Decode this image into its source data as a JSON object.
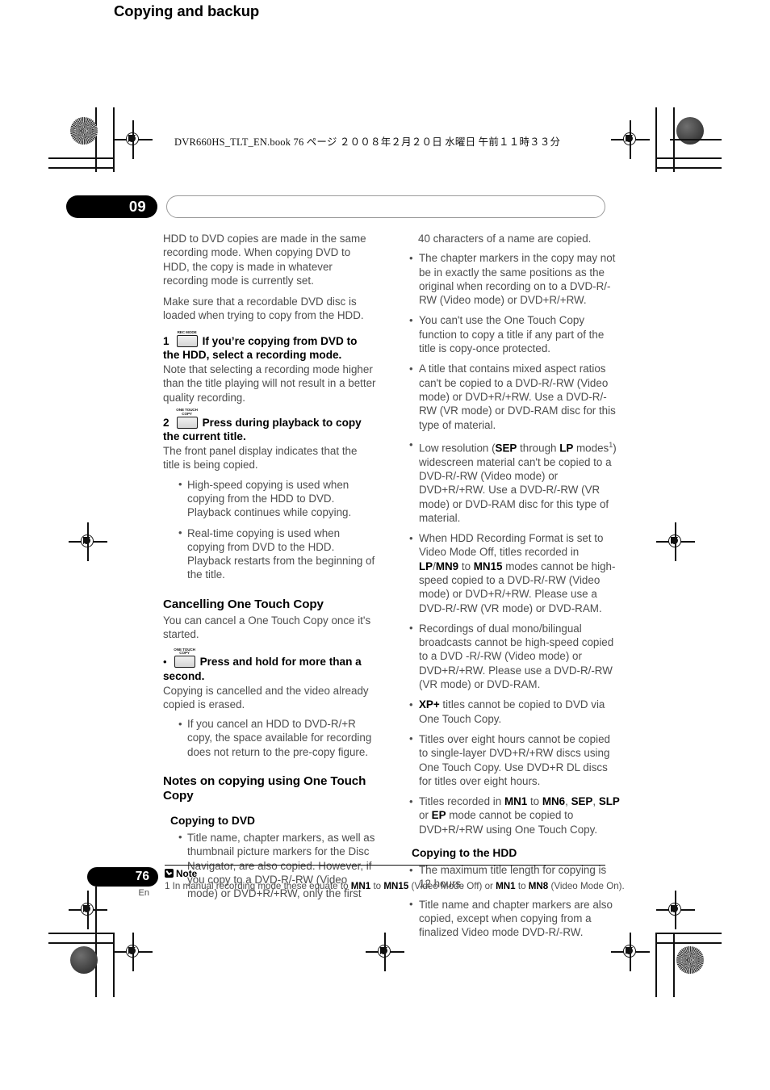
{
  "imprint": "DVR660HS_TLT_EN.book   76 ページ   ２００８年２月２０日   水曜日   午前１１時３３分",
  "chapter": {
    "number": "09",
    "title": "Copying and backup"
  },
  "left_column": {
    "intro_1": "HDD to DVD copies are made in the same recording mode. When copying DVD to HDD, the copy is made in whatever recording mode is currently set.",
    "intro_2": "Make sure that a recordable DVD disc is loaded when trying to copy from the HDD.",
    "step1": {
      "number": "1",
      "key_label_line1": "REC MODE",
      "key_name": "rec-mode-button",
      "title": "If you’re copying from DVD to the HDD, select a recording mode.",
      "body": "Note that selecting a recording mode higher than the title playing will not result in a better quality recording."
    },
    "step2": {
      "number": "2",
      "key_label_line1": "ONE TOUCH",
      "key_label_line2": "COPY",
      "key_name": "one-touch-copy-button",
      "title": "Press during playback to copy the current title.",
      "body": "The front panel display indicates that the title is being copied.",
      "bullets": [
        "High-speed copying is used when copying from the HDD to DVD. Playback continues while copying.",
        "Real-time copying is used when copying from DVD to the HDD. Playback restarts from the beginning of the title."
      ]
    },
    "cancel_section": {
      "heading": "Cancelling One Touch Copy",
      "intro": "You can cancel a One Touch Copy once it's started.",
      "action": {
        "key_label_line1": "ONE TOUCH",
        "key_label_line2": "COPY",
        "key_name": "one-touch-copy-button",
        "title": "Press and hold for more than a second.",
        "body": "Copying is cancelled and the video already copied is erased."
      },
      "bullets": [
        "If you cancel an HDD to DVD-R/+R copy, the space available for recording does not return to the pre-copy figure."
      ]
    },
    "notes_section": {
      "heading": "Notes on copying using One Touch Copy",
      "subheading": "Copying to DVD",
      "bullet_continued": "Title name, chapter markers, as well as thumbnail picture markers for the Disc Navigator, are also copied. However, if you copy to a DVD-R/-RW (Video mode) or DVD+R/+RW, only the first"
    }
  },
  "right_column": {
    "continued_text": "40 characters of a name are copied.",
    "dvd_bullets": [
      {
        "parts": [
          {
            "t": "The chapter markers in the copy may not be in exactly the same positions as the original when recording on to a DVD-R/-RW (Video mode) or DVD+R/+RW.",
            "b": false
          }
        ]
      },
      {
        "parts": [
          {
            "t": "You can't use the One Touch Copy function to copy a title if any part of the title is copy-once protected.",
            "b": false
          }
        ]
      },
      {
        "parts": [
          {
            "t": "A title that contains mixed aspect ratios can't be copied to a DVD-R/-RW (Video mode) or DVD+R/+RW. Use a DVD-R/-RW (VR mode) or DVD-RAM disc for this type of material.",
            "b": false
          }
        ]
      },
      {
        "parts": [
          {
            "t": "Low resolution (",
            "b": false
          },
          {
            "t": "SEP",
            "b": true
          },
          {
            "t": " through ",
            "b": false
          },
          {
            "t": "LP",
            "b": true
          },
          {
            "t": " modes",
            "b": false
          },
          {
            "t": "1",
            "sup": true
          },
          {
            "t": ") widescreen material can't be copied to a DVD-R/-RW (Video mode) or DVD+R/+RW. Use a DVD-R/-RW (VR mode) or DVD-RAM disc for this type of material.",
            "b": false
          }
        ]
      },
      {
        "parts": [
          {
            "t": "When HDD Recording Format is set to Video Mode Off, titles recorded in ",
            "b": false
          },
          {
            "t": "LP",
            "b": true
          },
          {
            "t": "/",
            "b": false
          },
          {
            "t": "MN9",
            "b": true
          },
          {
            "t": " to ",
            "b": false
          },
          {
            "t": "MN15",
            "b": true
          },
          {
            "t": " modes cannot be high-speed copied to a DVD-R/-RW (Video mode) or DVD+R/+RW. Please use a DVD-R/-RW (VR mode) or DVD-RAM.",
            "b": false
          }
        ]
      },
      {
        "parts": [
          {
            "t": "Recordings of dual mono/bilingual broadcasts cannot be high-speed copied to a DVD -R/-RW (Video mode) or DVD+R/+RW. Please use a DVD-R/-RW (VR mode) or DVD-RAM.",
            "b": false
          }
        ]
      },
      {
        "parts": [
          {
            "t": "XP+",
            "b": true
          },
          {
            "t": " titles cannot be copied to DVD via One Touch Copy.",
            "b": false
          }
        ]
      },
      {
        "parts": [
          {
            "t": "Titles over eight hours cannot be copied to single-layer DVD+R/+RW discs using One Touch Copy. Use DVD+R DL discs for titles over eight hours.",
            "b": false
          }
        ]
      },
      {
        "parts": [
          {
            "t": "Titles recorded in ",
            "b": false
          },
          {
            "t": "MN1",
            "b": true
          },
          {
            "t": " to ",
            "b": false
          },
          {
            "t": "MN6",
            "b": true
          },
          {
            "t": ", ",
            "b": false
          },
          {
            "t": "SEP",
            "b": true
          },
          {
            "t": ", ",
            "b": false
          },
          {
            "t": "SLP",
            "b": true
          },
          {
            "t": " or ",
            "b": false
          },
          {
            "t": "EP",
            "b": true
          },
          {
            "t": " mode cannot be copied to DVD+R/+RW using One Touch Copy.",
            "b": false
          }
        ]
      }
    ],
    "hdd_subheading": "Copying to the HDD",
    "hdd_bullets": [
      {
        "parts": [
          {
            "t": "The maximum title length for copying is 12 hours.",
            "b": false
          }
        ]
      },
      {
        "parts": [
          {
            "t": "Title name and chapter markers are also copied, except when copying from a finalized Video mode DVD-R/-RW.",
            "b": false
          }
        ]
      }
    ]
  },
  "footer": {
    "page_number": "76",
    "language": "En",
    "note_label": "Note",
    "note_parts": [
      {
        "t": "1 In manual recording mode these equate to ",
        "b": false
      },
      {
        "t": "MN1",
        "b": true
      },
      {
        "t": " to ",
        "b": false
      },
      {
        "t": "MN15",
        "b": true
      },
      {
        "t": " (Video Mode Off) or ",
        "b": false
      },
      {
        "t": "MN1",
        "b": true
      },
      {
        "t": " to ",
        "b": false
      },
      {
        "t": "MN8",
        "b": true
      },
      {
        "t": " (Video Mode On).",
        "b": false
      }
    ]
  }
}
